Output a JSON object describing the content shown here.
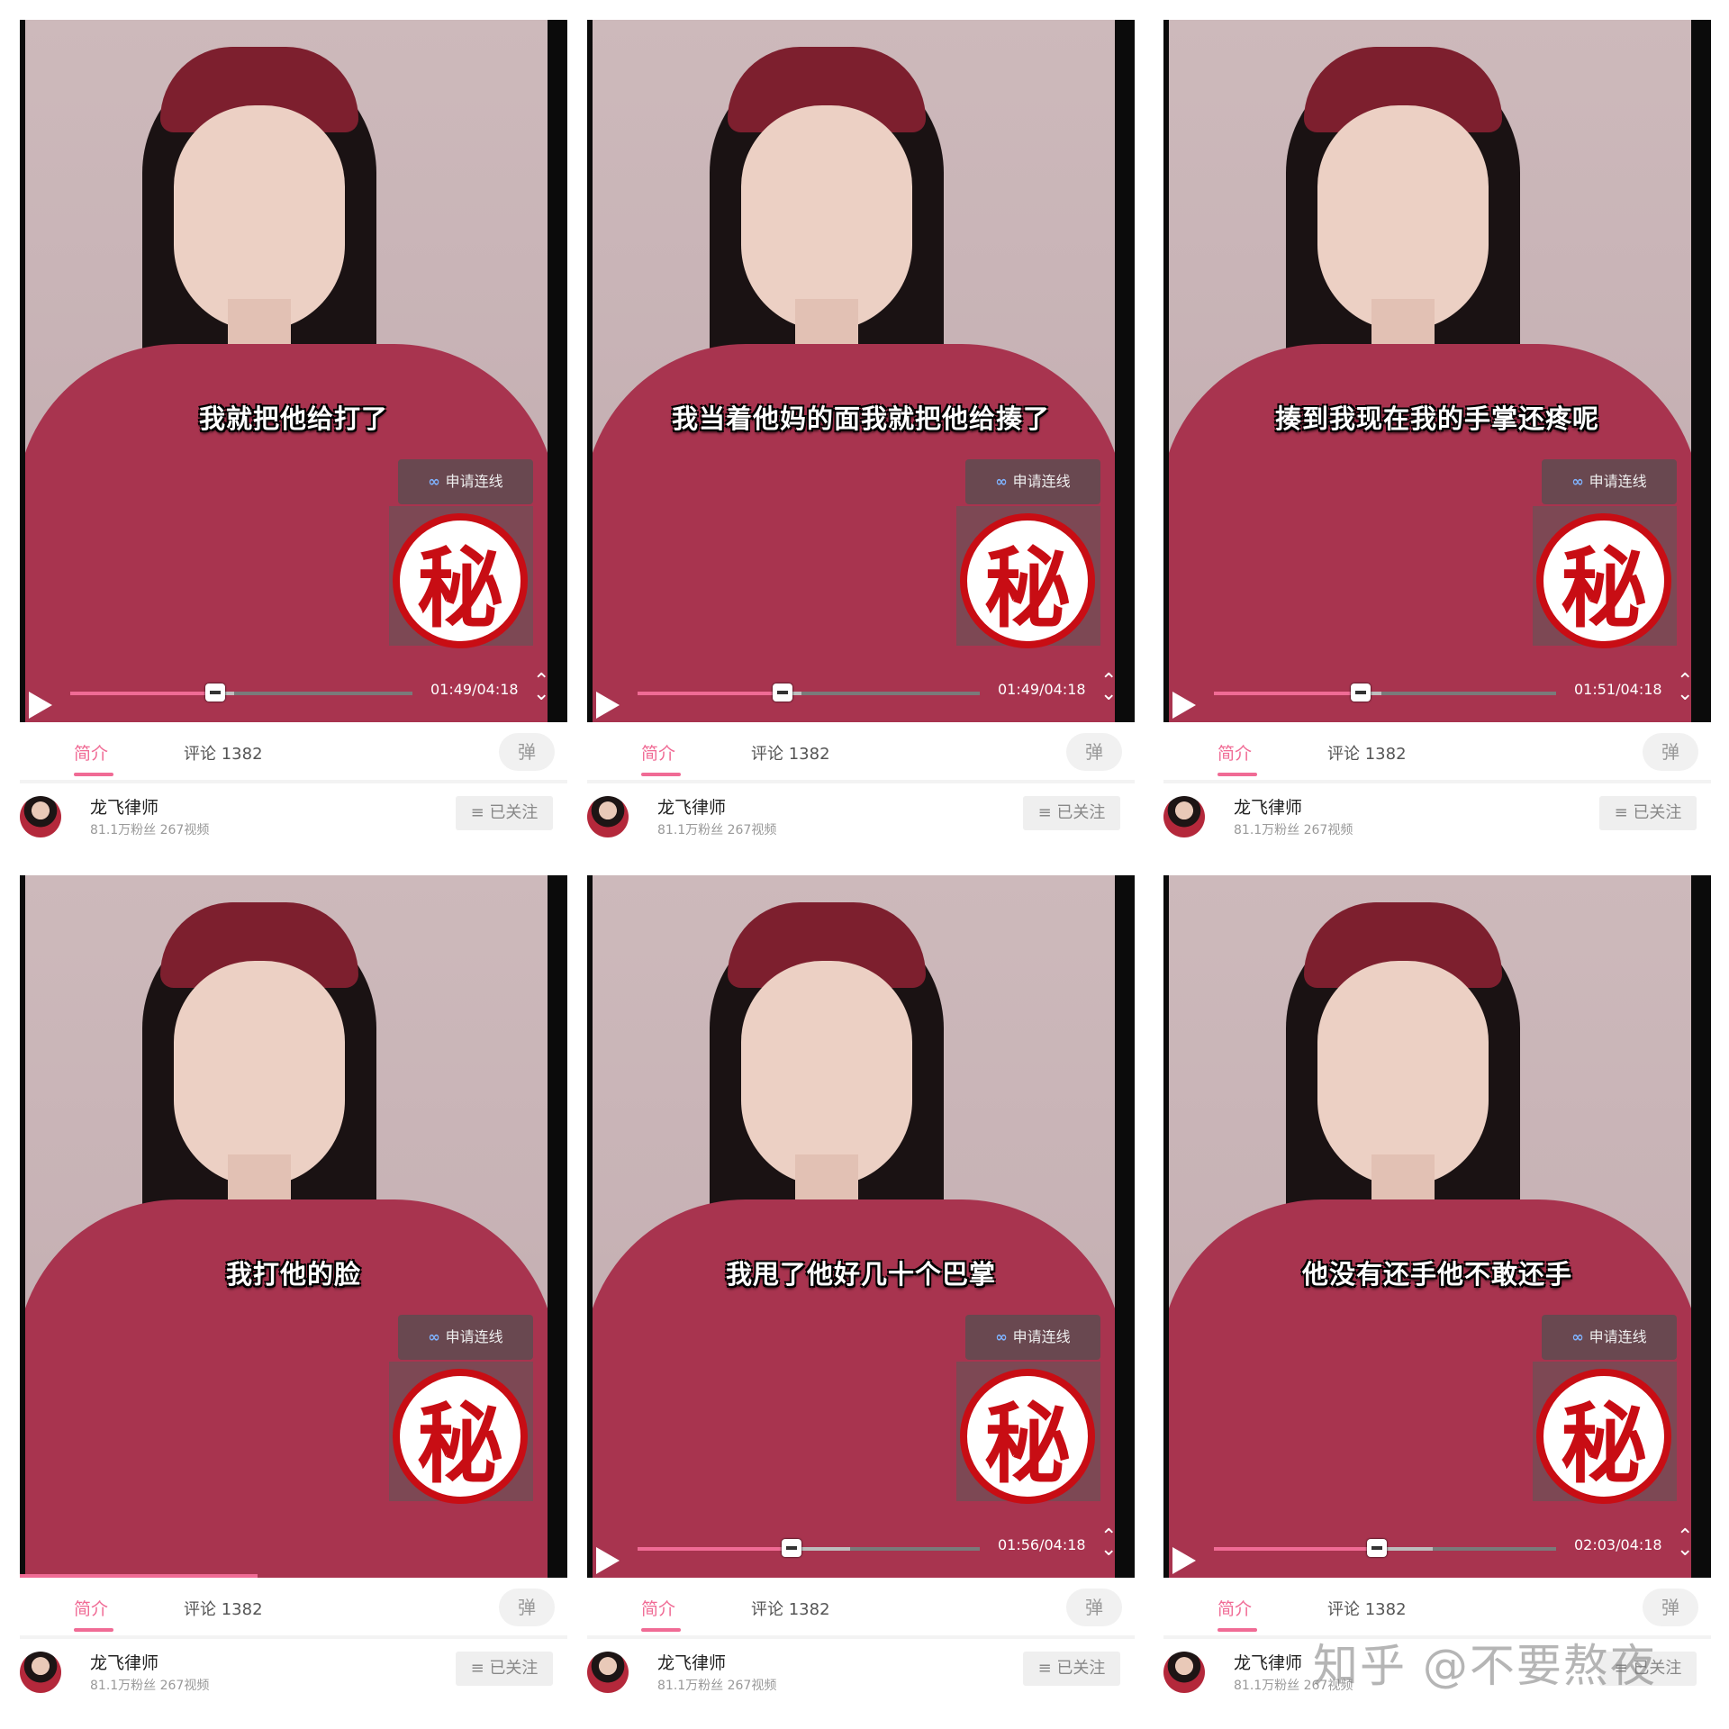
{
  "panels": [
    {
      "subtitle": "我就把他给打了",
      "time": "01:49/04:18",
      "progress": 0.4225,
      "buffered": 0.48
    },
    {
      "subtitle": "我当着他妈的面我就把他给揍了",
      "time": "01:49/04:18",
      "progress": 0.4225,
      "buffered": 0.48
    },
    {
      "subtitle": "揍到我现在我的手掌还疼呢",
      "time": "01:51/04:18",
      "progress": 0.4302,
      "buffered": 0.49
    },
    {
      "subtitle": "我打他的脸",
      "time": "",
      "progress": 0.434,
      "buffered": 0.5
    },
    {
      "subtitle": "我甩了他好几十个巴掌",
      "time": "01:56/04:18",
      "progress": 0.4496,
      "buffered": 0.62
    },
    {
      "subtitle": "他没有还手他不敢还手",
      "time": "02:03/04:18",
      "progress": 0.4767,
      "buffered": 0.64
    }
  ],
  "video": {
    "connect_label": "申请连线",
    "connect_icon": "link-loop-icon",
    "secret_stamp": "秘",
    "play_icon": "play-icon",
    "fullscreen_icon": "expand-updown-icon"
  },
  "tabs": {
    "intro": "简介",
    "comments": "评论 1382",
    "danmaku_icon": "弹"
  },
  "author": {
    "name": "龙飞律师",
    "stats": "81.1万粉丝    267视频",
    "follow_label": "≡ 已关注"
  },
  "watermark": "知乎 @不要熬夜",
  "colors": {
    "accent": "#f06b95",
    "stamp_red": "#c80d14",
    "sweater": "#a8344f"
  }
}
